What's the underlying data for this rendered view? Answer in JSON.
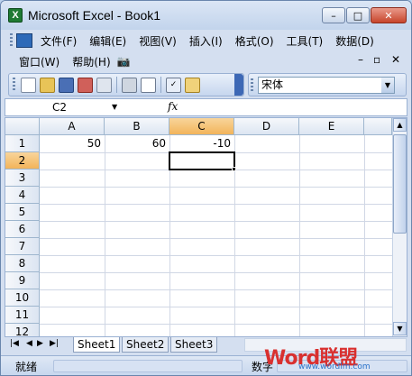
{
  "window": {
    "title": "Microsoft Excel - Book1",
    "app_icon_label": "X",
    "controls": {
      "minimize": "–",
      "maximize": "□",
      "close": "✕"
    }
  },
  "menubar": {
    "items": [
      "文件(F)",
      "编辑(E)",
      "视图(V)",
      "插入(I)",
      "格式(O)",
      "工具(T)",
      "数据(D)"
    ],
    "row2": [
      "窗口(W)",
      "帮助(H)"
    ],
    "mdi_controls": {
      "minimize": "–",
      "restore": "▫",
      "close": "✕"
    }
  },
  "toolbar": {
    "icons": [
      "new-icon",
      "open-icon",
      "save-icon",
      "permission-icon",
      "mail-icon",
      "print-icon",
      "print-preview-icon",
      "spelling-icon",
      "research-icon"
    ],
    "font_name": "宋体"
  },
  "formula_bar": {
    "name_box": "C2",
    "fx_label": "fx",
    "value": ""
  },
  "sheet": {
    "columns": [
      "A",
      "B",
      "C",
      "D",
      "E"
    ],
    "active_column": "C",
    "rows": [
      "1",
      "2",
      "3",
      "4",
      "5",
      "6",
      "7",
      "8",
      "9",
      "10",
      "11",
      "12"
    ],
    "active_row": "2",
    "cells": [
      {
        "ref": "A1",
        "value": "50"
      },
      {
        "ref": "B1",
        "value": "60"
      },
      {
        "ref": "C1",
        "value": "-10"
      }
    ]
  },
  "tabs": {
    "sheets": [
      "Sheet1",
      "Sheet2",
      "Sheet3"
    ],
    "active": "Sheet1",
    "nav": [
      "|◀",
      "◀",
      "▶",
      "▶|"
    ]
  },
  "status": {
    "mode": "就绪",
    "indicator": "数字"
  },
  "watermark": {
    "logo_text": "Word联盟",
    "url": "www.wordlm.com"
  },
  "colors": {
    "accent": "#3d68b5",
    "active_header": "#f2b45a",
    "close_button": "#c7452c"
  }
}
